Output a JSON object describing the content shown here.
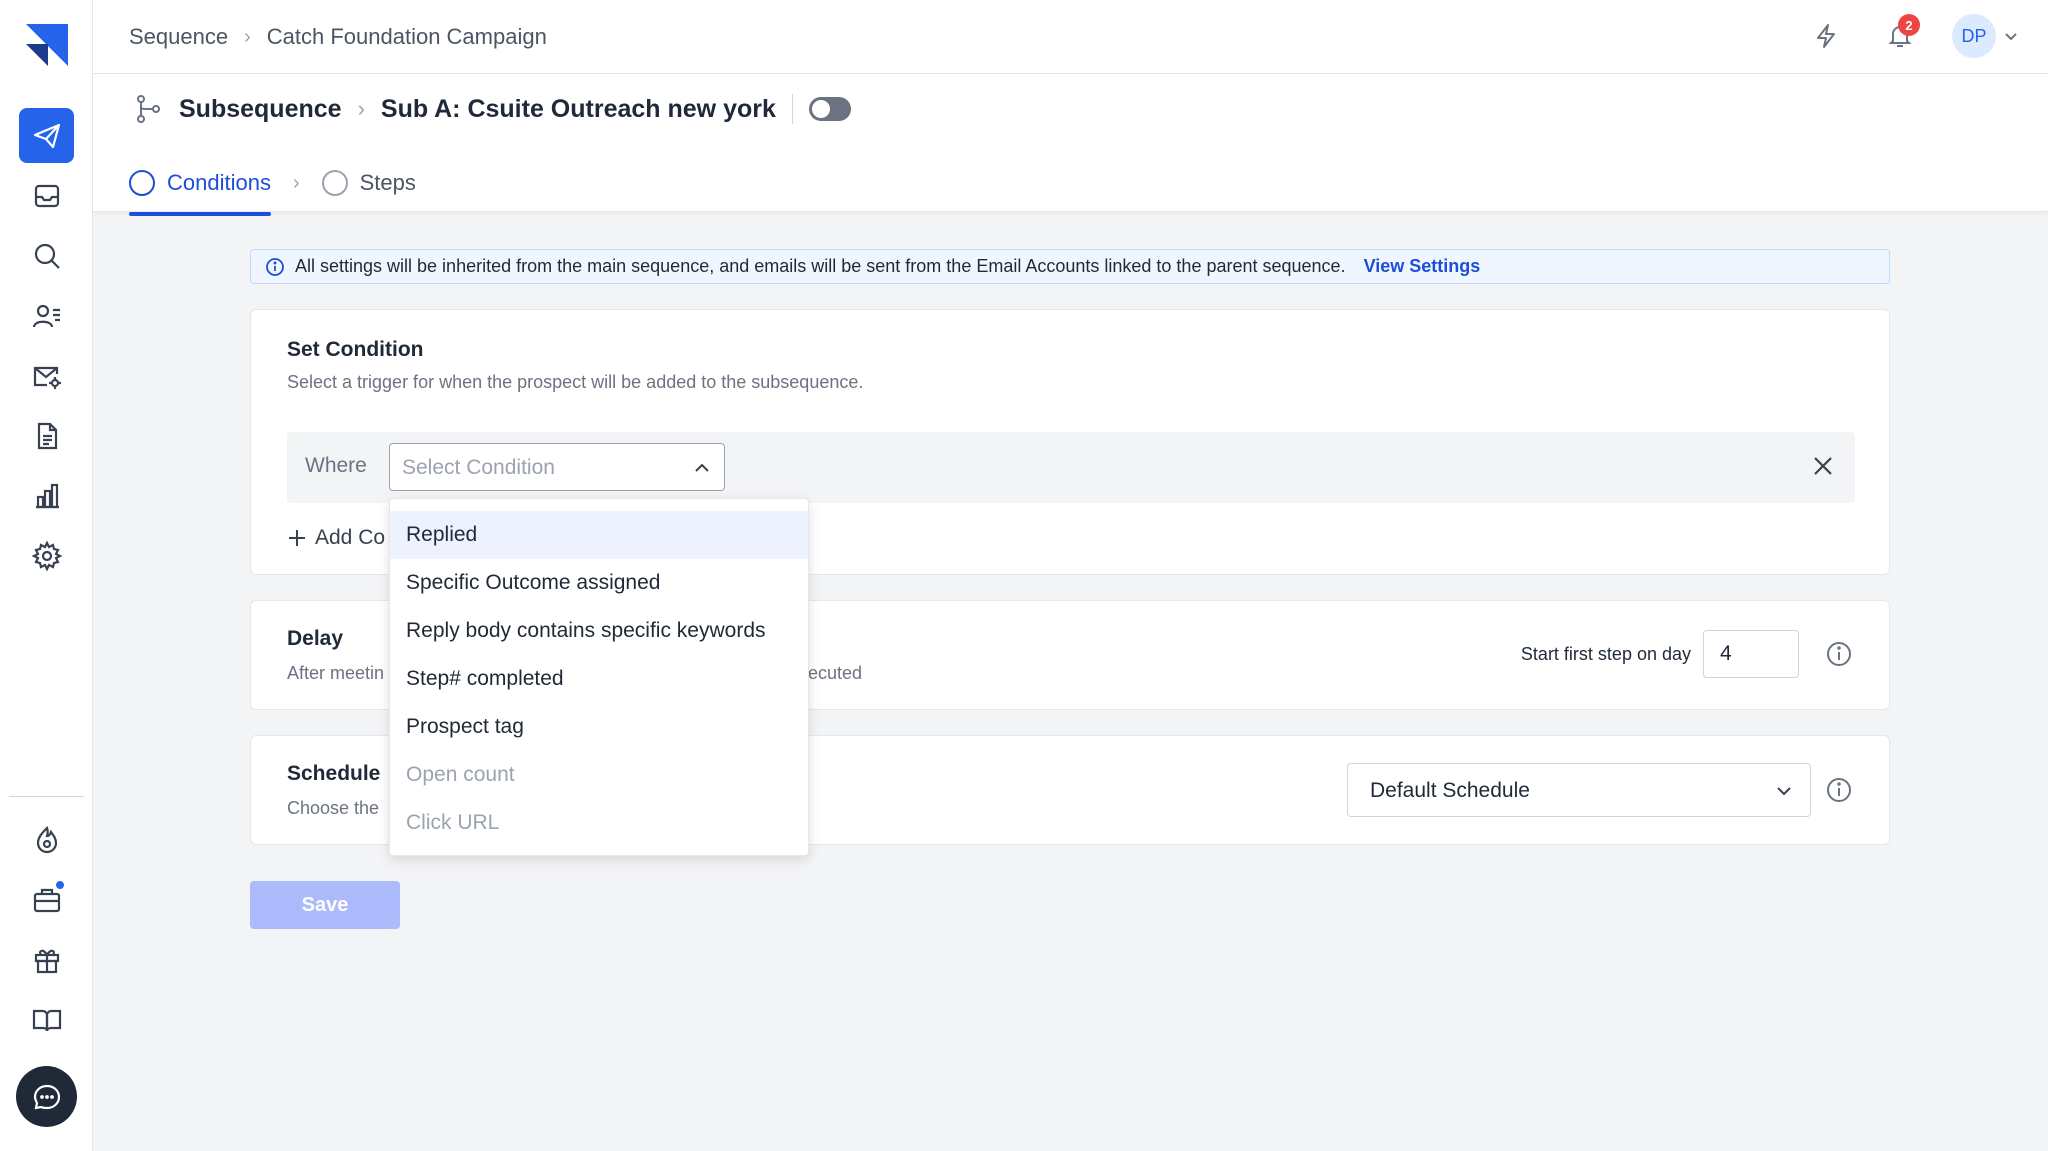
{
  "breadcrumb": {
    "root": "Sequence",
    "current": "Catch Foundation Campaign"
  },
  "notifications": {
    "count": "2"
  },
  "user": {
    "initials": "DP"
  },
  "subheader": {
    "section": "Subsequence",
    "name": "Sub A: Csuite Outreach new york"
  },
  "tabs": [
    {
      "label": "Conditions"
    },
    {
      "label": "Steps"
    }
  ],
  "info_bar": {
    "text": "All settings will be inherited from the main sequence, and emails will be sent from the Email Accounts linked to the parent sequence.",
    "link": "View Settings"
  },
  "condition": {
    "title": "Set Condition",
    "desc": "Select a trigger for when the prospect will be added to the subsequence.",
    "where_label": "Where",
    "select_placeholder": "Select Condition",
    "add_label": "Add Co"
  },
  "delay": {
    "title": "Delay",
    "desc_left": "After meetin",
    "desc_right": "ecuted",
    "start_label": "Start first step on day",
    "start_value": "4"
  },
  "schedule": {
    "title": "Schedule",
    "desc": "Choose the",
    "value": "Default Schedule"
  },
  "save_label": "Save",
  "dropdown": {
    "options": [
      {
        "label": "Replied"
      },
      {
        "label": "Specific Outcome assigned"
      },
      {
        "label": "Reply body contains specific keywords"
      },
      {
        "label": "Step# completed"
      },
      {
        "label": "Prospect tag"
      },
      {
        "label": "Open count"
      },
      {
        "label": "Click URL"
      }
    ]
  },
  "colors": {
    "accent": "#2563eb",
    "primary_text": "#1f2937",
    "save_disabled": "#a5b4fc",
    "badge": "#ef4444"
  }
}
